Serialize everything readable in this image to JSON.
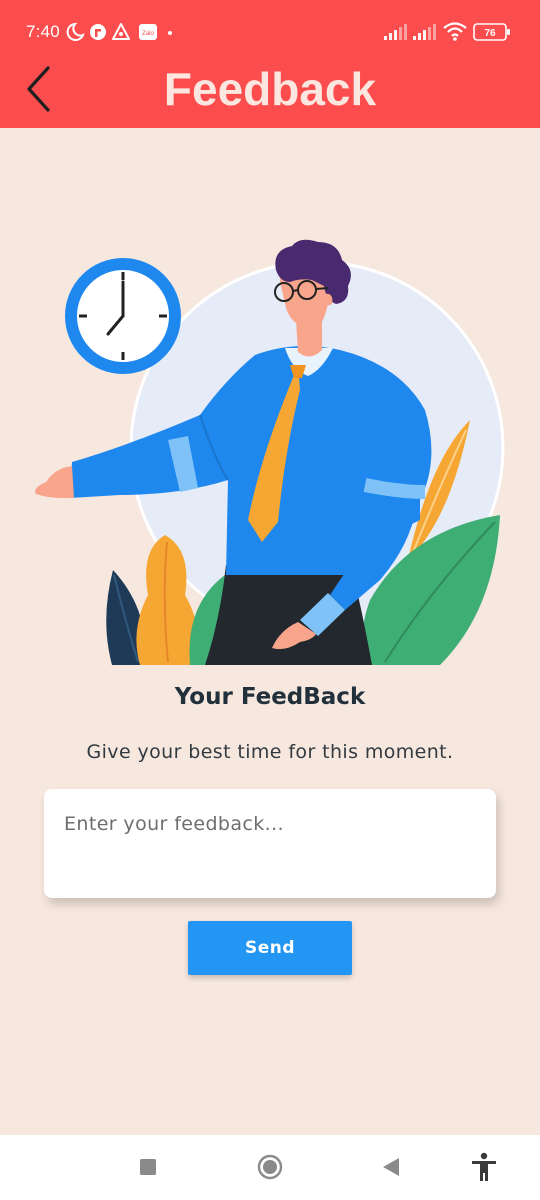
{
  "status_bar": {
    "time": "7:40",
    "battery_level": "76",
    "left_icons": [
      "moon-icon",
      "facebook-messenger-icon",
      "app-triangle-icon",
      "zalo-icon",
      "notification-dot-icon"
    ],
    "right_icons": [
      "signal-icon",
      "signal-icon",
      "wifi-icon",
      "battery-icon"
    ]
  },
  "header": {
    "title": "Feedback",
    "background_color": "#fb4d4e",
    "title_color": "#fbe7df"
  },
  "main": {
    "heading": "Your FeedBack",
    "subtitle": "Give your best time for this moment.",
    "feedback_input": {
      "placeholder": "Enter your feedback...",
      "value": ""
    },
    "send_label": "Send",
    "send_color": "#2396f3"
  },
  "nav_bar": {
    "buttons": [
      "recent-apps-icon",
      "home-icon",
      "back-triangle-icon",
      "accessibility-icon"
    ]
  },
  "colors": {
    "page_background": "#f7e8df"
  }
}
